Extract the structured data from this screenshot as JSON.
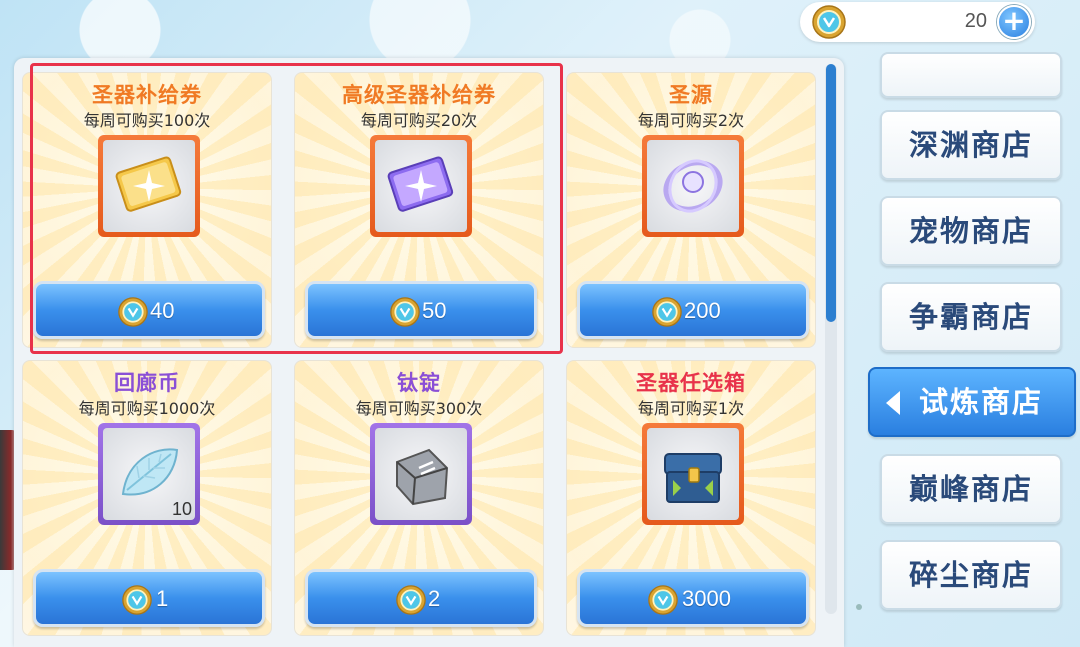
{
  "currency": {
    "amount": "20",
    "icon": "trial-coin-icon",
    "add_icon": "plus-icon"
  },
  "colors": {
    "orange_name": "#f07a24",
    "purple_name": "#8a4fd6",
    "red_name": "#e8324a",
    "button_blue": "#2a7fe0",
    "highlight": "#e8324a"
  },
  "items": [
    {
      "name": "圣器补给券",
      "limit": "每周可购买100次",
      "price": "40",
      "qty": "",
      "icon": "gold-ticket-icon"
    },
    {
      "name": "高级圣器补给券",
      "limit": "每周可购买20次",
      "price": "50",
      "qty": "",
      "icon": "purple-ticket-icon"
    },
    {
      "name": "圣源",
      "limit": "每周可购买2次",
      "price": "200",
      "qty": "",
      "icon": "holy-source-icon"
    },
    {
      "name": "回廊币",
      "limit": "每周可购买1000次",
      "price": "1",
      "qty": "10",
      "icon": "leaf-crystal-icon"
    },
    {
      "name": "钛锭",
      "limit": "每周可购买300次",
      "price": "2",
      "qty": "",
      "icon": "titanium-ingot-icon"
    },
    {
      "name": "圣器任选箱",
      "limit": "每周可购买1次",
      "price": "3000",
      "qty": "",
      "icon": "chest-icon"
    }
  ],
  "sidebar": {
    "items": [
      {
        "label": "深渊商店"
      },
      {
        "label": "宠物商店"
      },
      {
        "label": "争霸商店"
      },
      {
        "label": "试炼商店"
      },
      {
        "label": "巅峰商店"
      },
      {
        "label": "碎尘商店"
      }
    ],
    "active_label": "试炼商店"
  }
}
